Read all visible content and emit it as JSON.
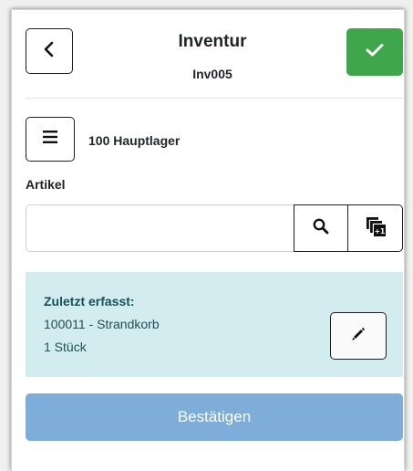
{
  "header": {
    "title": "Inventur",
    "subtitle": "Inv005",
    "back_icon": "chevron-left-icon",
    "confirm_icon": "check-icon",
    "confirm_color": "#3fa64b"
  },
  "location": {
    "menu_icon": "hamburger-menu-icon",
    "label": "100 Hauptlager"
  },
  "article": {
    "label": "Artikel",
    "input_value": "",
    "input_placeholder": "",
    "search_icon": "search-icon",
    "add_icon": "copy-plus-one-icon"
  },
  "last_captured": {
    "title": "Zuletzt erfasst:",
    "item": "100011 - Strandkorb",
    "quantity": "1 Stück",
    "edit_icon": "pencil-icon",
    "background_color": "#d3ecef"
  },
  "footer": {
    "confirm_label": "Bestätigen",
    "button_color": "#7eadd9"
  }
}
